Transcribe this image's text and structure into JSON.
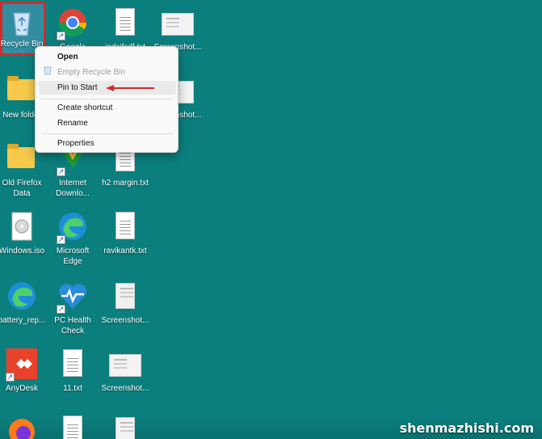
{
  "desktop": {
    "icons": {
      "recycle_bin": "Recycle Bin",
      "chrome": "Google Chrome",
      "txt_top": "jpdsjfsdf.txt",
      "shot_top": "Screenshot...",
      "new_folder": "New folder",
      "shot_2": "Screenshot...",
      "old_firefox": "Old Firefox\nData",
      "idm": "Internet\nDownlo...",
      "h2_margin": "h2 margin.txt",
      "windows_iso": "Windows.iso",
      "edge": "Microsoft\nEdge",
      "ravikantk": "ravikantk.txt",
      "battery": "battery_rep...",
      "pc_health": "PC Health\nCheck",
      "shot_3": "Screenshot...",
      "anydesk": "AnyDesk",
      "txt_11": "11.txt",
      "shot_4": "Screenshot..."
    }
  },
  "context_menu": {
    "open": "Open",
    "empty": "Empty Recycle Bin",
    "pin": "Pin to Start",
    "create_shortcut": "Create shortcut",
    "rename": "Rename",
    "properties": "Properties"
  },
  "watermark": "shenmazhishi.com",
  "colors": {
    "desktop_bg": "#0b7f7e",
    "selection_outline": "#d42a2a",
    "arrow": "#d42a2a"
  }
}
